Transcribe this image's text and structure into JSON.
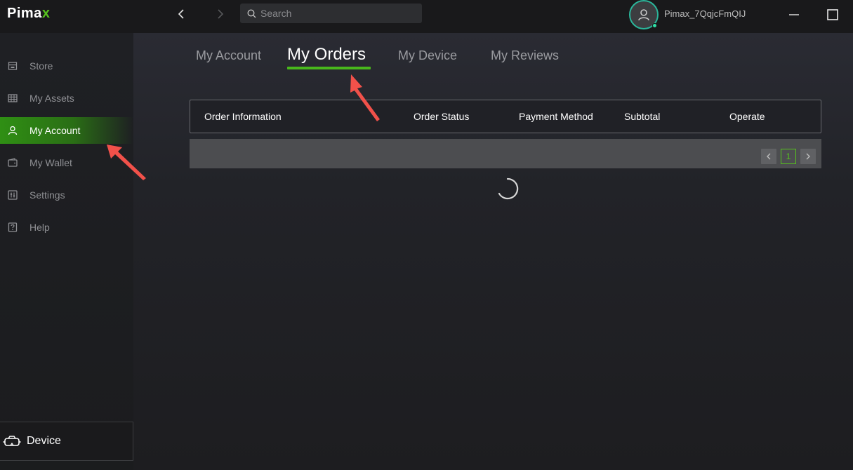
{
  "app": {
    "brand_main": "Pima",
    "brand_accent": "x",
    "accent_color": "#56c21e"
  },
  "topbar": {
    "search_placeholder": "Search",
    "username": "Pimax_7QqjcFmQIJ"
  },
  "sidebar": {
    "items": [
      {
        "label": "Store",
        "icon": "store-icon"
      },
      {
        "label": "My Assets",
        "icon": "grid-icon"
      },
      {
        "label": "My Account",
        "icon": "user-icon",
        "active": true
      },
      {
        "label": "My Wallet",
        "icon": "wallet-icon"
      },
      {
        "label": "Settings",
        "icon": "settings-icon"
      },
      {
        "label": "Help",
        "icon": "help-icon"
      }
    ],
    "device_label": "Device"
  },
  "tabs": [
    {
      "label": "My Account"
    },
    {
      "label": "My Orders",
      "active": true
    },
    {
      "label": "My Device"
    },
    {
      "label": "My Reviews"
    }
  ],
  "table": {
    "columns": [
      "Order Information",
      "Order Status",
      "Payment Method",
      "Subtotal",
      "Operate"
    ],
    "pagination": {
      "current_page": "1",
      "prev": "‹",
      "next": "›"
    }
  }
}
